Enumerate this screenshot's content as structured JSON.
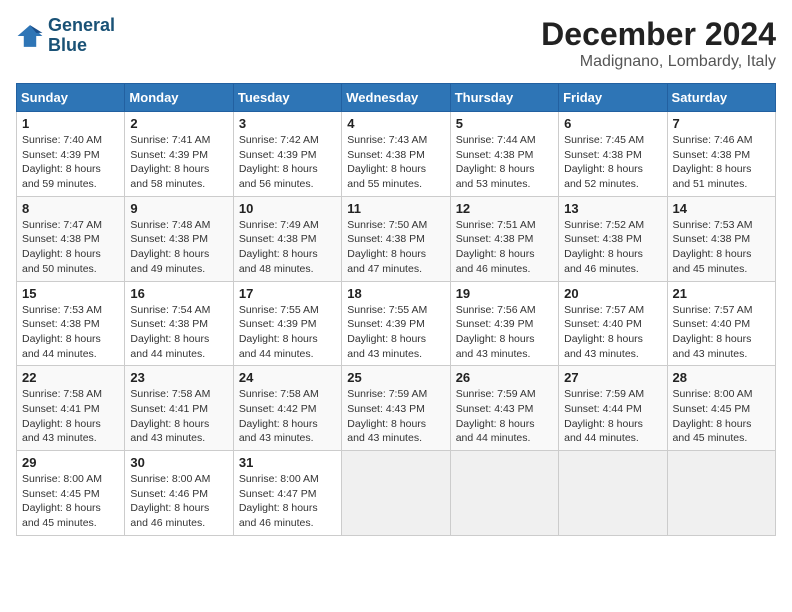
{
  "logo": {
    "line1": "General",
    "line2": "Blue"
  },
  "title": "December 2024",
  "subtitle": "Madignano, Lombardy, Italy",
  "columns": [
    "Sunday",
    "Monday",
    "Tuesday",
    "Wednesday",
    "Thursday",
    "Friday",
    "Saturday"
  ],
  "weeks": [
    [
      {
        "day": "1",
        "lines": [
          "Sunrise: 7:40 AM",
          "Sunset: 4:39 PM",
          "Daylight: 8 hours",
          "and 59 minutes."
        ]
      },
      {
        "day": "2",
        "lines": [
          "Sunrise: 7:41 AM",
          "Sunset: 4:39 PM",
          "Daylight: 8 hours",
          "and 58 minutes."
        ]
      },
      {
        "day": "3",
        "lines": [
          "Sunrise: 7:42 AM",
          "Sunset: 4:39 PM",
          "Daylight: 8 hours",
          "and 56 minutes."
        ]
      },
      {
        "day": "4",
        "lines": [
          "Sunrise: 7:43 AM",
          "Sunset: 4:38 PM",
          "Daylight: 8 hours",
          "and 55 minutes."
        ]
      },
      {
        "day": "5",
        "lines": [
          "Sunrise: 7:44 AM",
          "Sunset: 4:38 PM",
          "Daylight: 8 hours",
          "and 53 minutes."
        ]
      },
      {
        "day": "6",
        "lines": [
          "Sunrise: 7:45 AM",
          "Sunset: 4:38 PM",
          "Daylight: 8 hours",
          "and 52 minutes."
        ]
      },
      {
        "day": "7",
        "lines": [
          "Sunrise: 7:46 AM",
          "Sunset: 4:38 PM",
          "Daylight: 8 hours",
          "and 51 minutes."
        ]
      }
    ],
    [
      {
        "day": "8",
        "lines": [
          "Sunrise: 7:47 AM",
          "Sunset: 4:38 PM",
          "Daylight: 8 hours",
          "and 50 minutes."
        ]
      },
      {
        "day": "9",
        "lines": [
          "Sunrise: 7:48 AM",
          "Sunset: 4:38 PM",
          "Daylight: 8 hours",
          "and 49 minutes."
        ]
      },
      {
        "day": "10",
        "lines": [
          "Sunrise: 7:49 AM",
          "Sunset: 4:38 PM",
          "Daylight: 8 hours",
          "and 48 minutes."
        ]
      },
      {
        "day": "11",
        "lines": [
          "Sunrise: 7:50 AM",
          "Sunset: 4:38 PM",
          "Daylight: 8 hours",
          "and 47 minutes."
        ]
      },
      {
        "day": "12",
        "lines": [
          "Sunrise: 7:51 AM",
          "Sunset: 4:38 PM",
          "Daylight: 8 hours",
          "and 46 minutes."
        ]
      },
      {
        "day": "13",
        "lines": [
          "Sunrise: 7:52 AM",
          "Sunset: 4:38 PM",
          "Daylight: 8 hours",
          "and 46 minutes."
        ]
      },
      {
        "day": "14",
        "lines": [
          "Sunrise: 7:53 AM",
          "Sunset: 4:38 PM",
          "Daylight: 8 hours",
          "and 45 minutes."
        ]
      }
    ],
    [
      {
        "day": "15",
        "lines": [
          "Sunrise: 7:53 AM",
          "Sunset: 4:38 PM",
          "Daylight: 8 hours",
          "and 44 minutes."
        ]
      },
      {
        "day": "16",
        "lines": [
          "Sunrise: 7:54 AM",
          "Sunset: 4:38 PM",
          "Daylight: 8 hours",
          "and 44 minutes."
        ]
      },
      {
        "day": "17",
        "lines": [
          "Sunrise: 7:55 AM",
          "Sunset: 4:39 PM",
          "Daylight: 8 hours",
          "and 44 minutes."
        ]
      },
      {
        "day": "18",
        "lines": [
          "Sunrise: 7:55 AM",
          "Sunset: 4:39 PM",
          "Daylight: 8 hours",
          "and 43 minutes."
        ]
      },
      {
        "day": "19",
        "lines": [
          "Sunrise: 7:56 AM",
          "Sunset: 4:39 PM",
          "Daylight: 8 hours",
          "and 43 minutes."
        ]
      },
      {
        "day": "20",
        "lines": [
          "Sunrise: 7:57 AM",
          "Sunset: 4:40 PM",
          "Daylight: 8 hours",
          "and 43 minutes."
        ]
      },
      {
        "day": "21",
        "lines": [
          "Sunrise: 7:57 AM",
          "Sunset: 4:40 PM",
          "Daylight: 8 hours",
          "and 43 minutes."
        ]
      }
    ],
    [
      {
        "day": "22",
        "lines": [
          "Sunrise: 7:58 AM",
          "Sunset: 4:41 PM",
          "Daylight: 8 hours",
          "and 43 minutes."
        ]
      },
      {
        "day": "23",
        "lines": [
          "Sunrise: 7:58 AM",
          "Sunset: 4:41 PM",
          "Daylight: 8 hours",
          "and 43 minutes."
        ]
      },
      {
        "day": "24",
        "lines": [
          "Sunrise: 7:58 AM",
          "Sunset: 4:42 PM",
          "Daylight: 8 hours",
          "and 43 minutes."
        ]
      },
      {
        "day": "25",
        "lines": [
          "Sunrise: 7:59 AM",
          "Sunset: 4:43 PM",
          "Daylight: 8 hours",
          "and 43 minutes."
        ]
      },
      {
        "day": "26",
        "lines": [
          "Sunrise: 7:59 AM",
          "Sunset: 4:43 PM",
          "Daylight: 8 hours",
          "and 44 minutes."
        ]
      },
      {
        "day": "27",
        "lines": [
          "Sunrise: 7:59 AM",
          "Sunset: 4:44 PM",
          "Daylight: 8 hours",
          "and 44 minutes."
        ]
      },
      {
        "day": "28",
        "lines": [
          "Sunrise: 8:00 AM",
          "Sunset: 4:45 PM",
          "Daylight: 8 hours",
          "and 45 minutes."
        ]
      }
    ],
    [
      {
        "day": "29",
        "lines": [
          "Sunrise: 8:00 AM",
          "Sunset: 4:45 PM",
          "Daylight: 8 hours",
          "and 45 minutes."
        ]
      },
      {
        "day": "30",
        "lines": [
          "Sunrise: 8:00 AM",
          "Sunset: 4:46 PM",
          "Daylight: 8 hours",
          "and 46 minutes."
        ]
      },
      {
        "day": "31",
        "lines": [
          "Sunrise: 8:00 AM",
          "Sunset: 4:47 PM",
          "Daylight: 8 hours",
          "and 46 minutes."
        ]
      },
      {
        "day": "",
        "lines": []
      },
      {
        "day": "",
        "lines": []
      },
      {
        "day": "",
        "lines": []
      },
      {
        "day": "",
        "lines": []
      }
    ]
  ]
}
